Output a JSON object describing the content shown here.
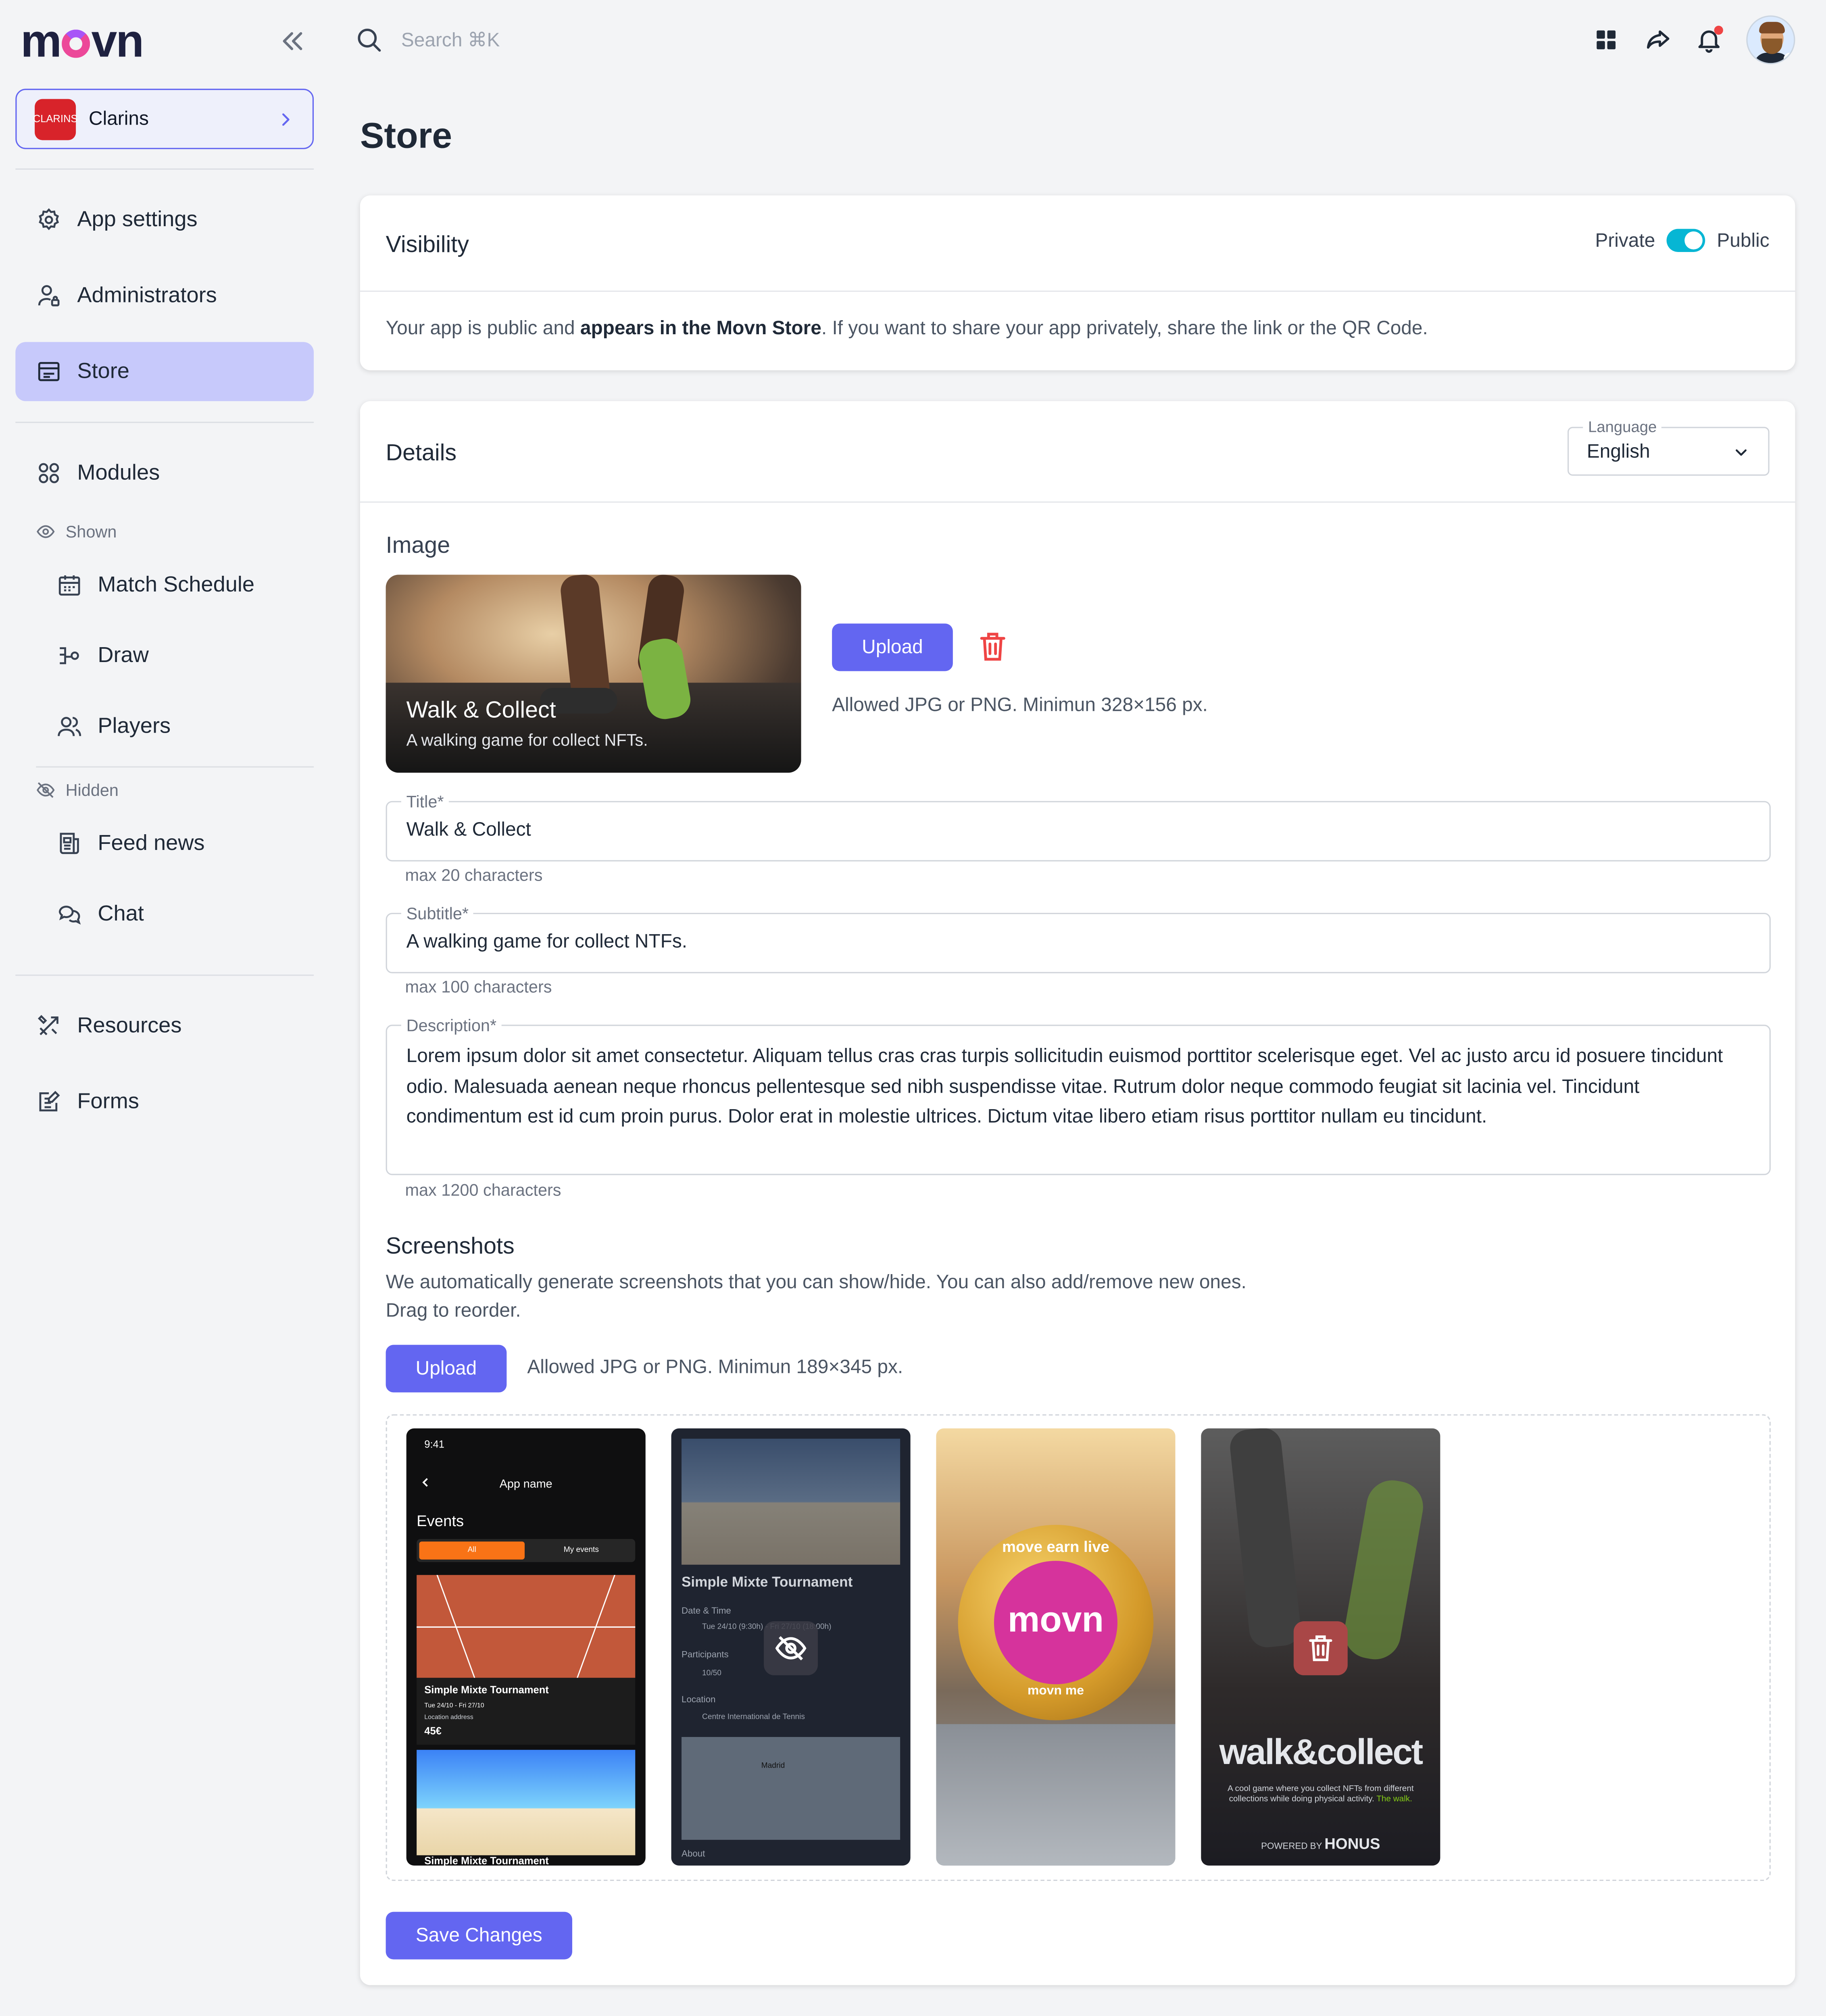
{
  "app": {
    "logo": "movn"
  },
  "org": {
    "name": "Clarins",
    "logo_text": "CLARINS"
  },
  "nav": {
    "app_settings": "App settings",
    "administrators": "Administrators",
    "store": "Store",
    "modules": "Modules",
    "shown_label": "Shown",
    "match_schedule": "Match Schedule",
    "draw": "Draw",
    "players": "Players",
    "hidden_label": "Hidden",
    "feed_news": "Feed news",
    "chat": "Chat",
    "resources": "Resources",
    "forms": "Forms"
  },
  "search": {
    "placeholder": "Search ⌘K"
  },
  "page": {
    "title": "Store"
  },
  "visibility": {
    "title": "Visibility",
    "private_label": "Private",
    "public_label": "Public",
    "is_public": true,
    "text_before": "Your app is public and ",
    "text_bold": "appears in the Movn Store",
    "text_after": ". If you want to share your app privately, share the link or the QR Code."
  },
  "details": {
    "title": "Details",
    "language_label": "Language",
    "language_value": "English",
    "image_label": "Image",
    "cover_title": "Walk & Collect",
    "cover_subtitle": "A walking game for collect NFTs.",
    "upload_label": "Upload",
    "image_hint": "Allowed JPG or PNG. Minimun 328×156 px.",
    "title_label": "Title*",
    "title_value": "Walk & Collect",
    "title_hint": "max 20 characters",
    "subtitle_label": "Subtitle*",
    "subtitle_value": "A walking game for collect NTFs.",
    "subtitle_hint": "max 100 characters",
    "description_label": "Description*",
    "description_value": "Lorem ipsum dolor sit amet consectetur. Aliquam tellus cras cras turpis sollicitudin euismod porttitor scelerisque eget. Vel ac justo arcu id posuere tincidunt odio. Malesuada aenean neque rhoncus pellentesque sed nibh suspendisse vitae. Rutrum dolor neque commodo feugiat sit lacinia vel. Tincidunt condimentum est id cum proin purus. Dolor erat in molestie ultrices. Dictum vitae libero etiam risus porttitor nullam eu tincidunt.",
    "description_hint": "max 1200 characters"
  },
  "screenshots": {
    "title": "Screenshots",
    "desc_line1": "We automatically generate screenshots that you can show/hide. You can also add/remove new ones.",
    "desc_line2": "Drag to reorder.",
    "upload_label": "Upload",
    "hint": "Allowed JPG or PNG. Minimun 189×345 px.",
    "shot1": {
      "time": "9:41",
      "app_name": "App name",
      "events": "Events",
      "tab_all": "All",
      "tab_my": "My events",
      "card_title": "Simple Mixte Tournament",
      "card_date": "Tue 24/10 - Fri 27/10",
      "card_address": "Location address",
      "card_price": "45€",
      "bottom_title": "Simple Mixte Tournament"
    },
    "shot2": {
      "title": "Simple Mixte Tournament",
      "date_label": "Date & Time",
      "date_value": "Tue 24/10 (9:30h) - Fri 27/10 (18:00h)",
      "participants_label": "Participants",
      "participants_value": "10/50",
      "location_label": "Location",
      "location_value": "Centre International de Tennis",
      "map_city": "Madrid",
      "about_label": "About"
    },
    "shot3": {
      "top": "move earn live",
      "logo": "movn",
      "bottom": "movn me"
    },
    "shot4": {
      "logo": "walk&collect",
      "desc_before": "A cool game where you collect NFTs from different collections while doing physical activity. ",
      "desc_highlight": "The walk.",
      "powered_by": "POWERED BY",
      "brand": "HONUS"
    }
  },
  "actions": {
    "save_label": "Save Changes"
  },
  "colors": {
    "accent": "#6366f1",
    "accent_soft": "#c7c9fb",
    "toggle": "#06b6d4",
    "danger": "#ef4444"
  }
}
